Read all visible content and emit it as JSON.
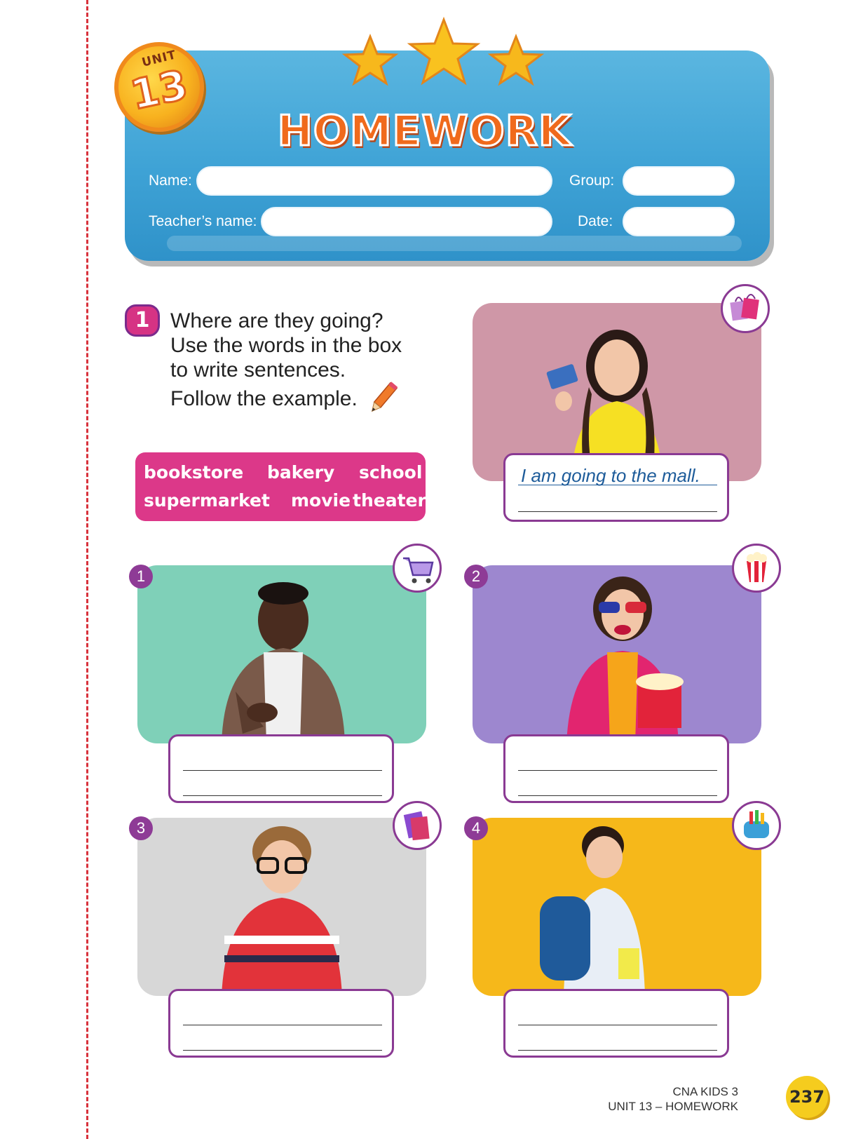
{
  "header": {
    "unit_label": "UNIT",
    "unit_number": "13",
    "title": "HOMEWORK",
    "fields": {
      "name_label": "Name:",
      "group_label": "Group:",
      "teacher_label": "Teacher’s name:",
      "date_label": "Date:"
    }
  },
  "exercise": {
    "number": "1",
    "instruction_lines": [
      "Where are they going?",
      "Use the words in the box",
      "to write sentences."
    ],
    "follow": "Follow the example.",
    "word_box": [
      "bookstore",
      "bakery",
      "school",
      "supermarket",
      "movie",
      "theater"
    ],
    "example_answer": "I am going to the mall.",
    "items": [
      {
        "number": "1",
        "icon": "shopping-cart-icon",
        "bg": "#7fd0b8"
      },
      {
        "number": "2",
        "icon": "popcorn-icon",
        "bg": "#9d87cf"
      },
      {
        "number": "3",
        "icon": "books-icon",
        "bg": "#d7d7d7"
      },
      {
        "number": "4",
        "icon": "school-supplies-icon",
        "bg": "#f6b81a"
      }
    ],
    "example_bg": "#cf97a7"
  },
  "footer": {
    "line1": "CNA KIDS 3",
    "line2": "UNIT 13 – HOMEWORK",
    "page_number": "237"
  },
  "colors": {
    "banner_blue": "#3fa3d6",
    "accent_pink": "#dc3889",
    "accent_purple": "#8a3a93",
    "margin_red": "#d8323c"
  }
}
